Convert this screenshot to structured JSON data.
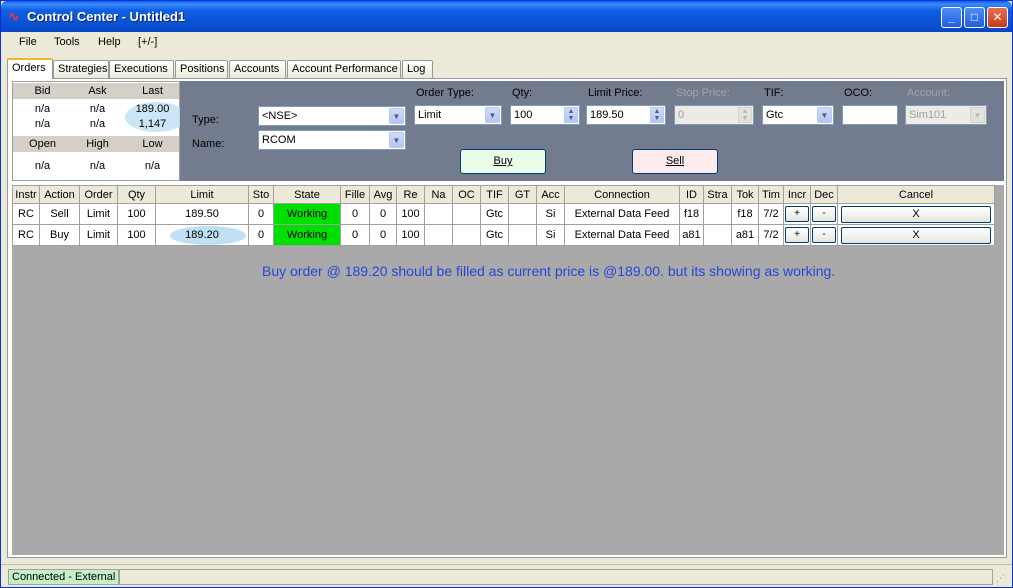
{
  "window": {
    "title": "Control Center - Untitled1",
    "icon": "wave-icon",
    "controls": [
      "minimize",
      "maximize",
      "close"
    ]
  },
  "menu": [
    {
      "label": "File"
    },
    {
      "label": "Tools"
    },
    {
      "label": "Help"
    },
    {
      "label": "[+/-]"
    }
  ],
  "tabs": [
    {
      "label": "Orders",
      "active": true
    },
    {
      "label": "Strategies"
    },
    {
      "label": "Executions"
    },
    {
      "label": "Positions"
    },
    {
      "label": "Accounts"
    },
    {
      "label": "Account Performance"
    },
    {
      "label": "Log"
    }
  ],
  "quote": {
    "headers1": [
      "Bid",
      "Ask",
      "Last"
    ],
    "row1": [
      "n/a",
      "n/a",
      "189.00"
    ],
    "row2": [
      "n/a",
      "n/a",
      "1,147"
    ],
    "headers2": [
      "Open",
      "High",
      "Low"
    ],
    "row3": [
      "n/a",
      "n/a",
      "n/a"
    ]
  },
  "entry": {
    "type_label": "Type:",
    "type_value": "<NSE>",
    "name_label": "Name:",
    "name_value": "RCOM",
    "order_type_label": "Order Type:",
    "order_type_value": "Limit",
    "qty_label": "Qty:",
    "qty_value": "100",
    "limit_label": "Limit Price:",
    "limit_value": "189.50",
    "stop_label": "Stop Price:",
    "stop_value": "0",
    "tif_label": "TIF:",
    "tif_value": "Gtc",
    "oco_label": "OCO:",
    "oco_value": "",
    "account_label": "Account:",
    "account_value": "Sim101",
    "buy_label": "Buy",
    "sell_label": "Sell"
  },
  "grid": {
    "columns": [
      "Instr",
      "Action",
      "Order",
      "Qty",
      "Limit",
      "Sto",
      "State",
      "Fille",
      "Avg",
      "Re",
      "Na",
      "OC",
      "TIF",
      "GT",
      "Acc",
      "Connection",
      "ID",
      "Stra",
      "Tok",
      "Tim",
      "Incr",
      "Dec",
      "Cancel"
    ],
    "rows": [
      {
        "instr": "RC",
        "action": "Sell",
        "order": "Limit",
        "qty": "100",
        "limit": "189.50",
        "stop": "0",
        "state": "Working",
        "filled": "0",
        "avg": "0",
        "remaining": "100",
        "name": "",
        "oco": "",
        "tif": "Gtc",
        "gtd": "",
        "account": "Si",
        "connection": "External Data Feed",
        "id": "f18",
        "strategy": "",
        "token": "f18",
        "time": "7/2",
        "incr": "+",
        "dec": "-",
        "cancel": "X"
      },
      {
        "instr": "RC",
        "action": "Buy",
        "order": "Limit",
        "qty": "100",
        "limit": "189.20",
        "stop": "0",
        "state": "Working",
        "filled": "0",
        "avg": "0",
        "remaining": "100",
        "name": "",
        "oco": "",
        "tif": "Gtc",
        "gtd": "",
        "account": "Si",
        "connection": "External Data Feed",
        "id": "a81",
        "strategy": "",
        "token": "a81",
        "time": "7/2",
        "incr": "+",
        "dec": "-",
        "cancel": "X"
      }
    ]
  },
  "annotation": "Buy order @ 189.20 should be filled as current price is @189.00. but its showing as working.",
  "status": {
    "text": "Connected - External"
  },
  "colors": {
    "working": "#00e000",
    "annotation": "#2746d8",
    "entry_panel": "#727c8e"
  }
}
